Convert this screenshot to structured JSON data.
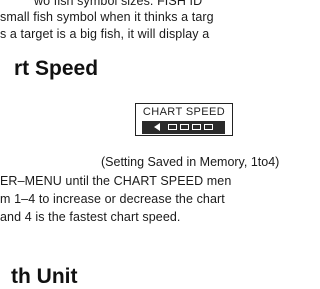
{
  "intro_lines": [
    "wo fish symbol sizes. FISH ID",
    "small fish symbol when it thinks a targ",
    "s a target is a big fish, it will display a"
  ],
  "section_heading": "rt  Speed",
  "lcd": {
    "title": "CHART SPEED",
    "level": 4,
    "max_level": 4
  },
  "caption": "(Setting Saved in Memory, 1to4)",
  "body_lines": [
    "ER–MENU  until the CHART SPEED men",
    "m 1–4 to increase or  decrease the chart",
    "and 4 is  the fastest chart speed."
  ],
  "next_heading": "th Unit"
}
